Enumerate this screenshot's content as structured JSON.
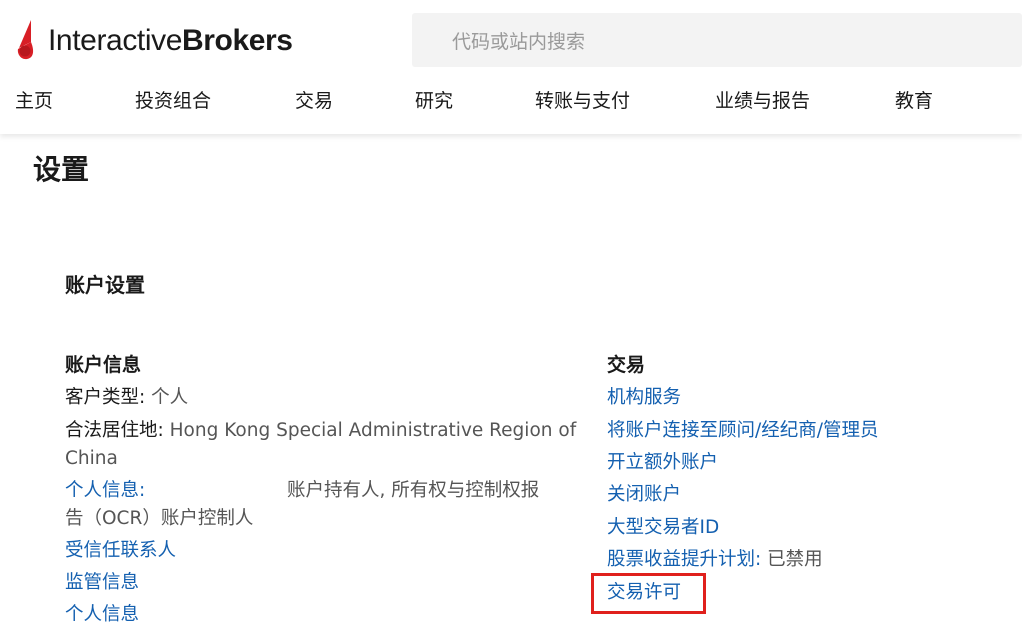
{
  "brand": {
    "logo_part1": "Interactive",
    "logo_part2": "Brokers",
    "accent_color": "#d81f26"
  },
  "search": {
    "placeholder": "代码或站内搜索"
  },
  "nav": {
    "items": [
      {
        "label": "主页"
      },
      {
        "label": "投资组合"
      },
      {
        "label": "交易"
      },
      {
        "label": "研究"
      },
      {
        "label": "转账与支付"
      },
      {
        "label": "业绩与报告"
      },
      {
        "label": "教育"
      }
    ]
  },
  "page": {
    "title": "设置",
    "section_title": "账户设置"
  },
  "account_info": {
    "heading": "账户信息",
    "client_type_label": "客户类型:",
    "client_type_value": "个人",
    "residence_label": "合法居住地:",
    "residence_value_line1": "Hong Kong Special Administrative Region of",
    "residence_value_line2": "China",
    "personal_info_label": "个人信息:",
    "personal_info_value_line1": "账户持有人, 所有权与控制权报",
    "personal_info_value_line2": "告（OCR）账户控制人",
    "trusted_contact": "受信任联系人",
    "regulatory_info": "监管信息",
    "personal_info_link": "个人信息"
  },
  "trading": {
    "heading": "交易",
    "institutional_services": "机构服务",
    "link_advisor": "将账户连接至顾问/经纪商/管理员",
    "open_additional": "开立额外账户",
    "close_account": "关闭账户",
    "large_trader": "大型交易者ID",
    "stock_yield_label": "股票收益提升计划:",
    "stock_yield_value": "已禁用",
    "trading_permissions": "交易许可",
    "highlight_color": "#e0201c"
  }
}
